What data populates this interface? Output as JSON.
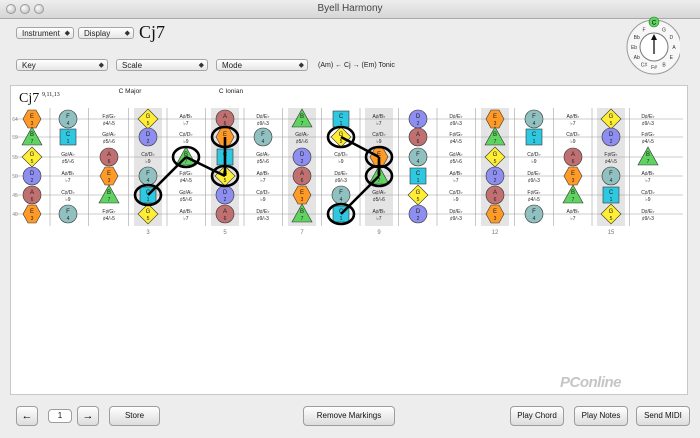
{
  "window": {
    "title": "Byell Harmony"
  },
  "toolbar": {
    "instrument": "Instrument",
    "display": "Display",
    "chord_name": "Cj7",
    "key": "Key",
    "scale": "Scale",
    "mode": "Mode",
    "progression": "(Am) ← Cj → (Em) Tonic"
  },
  "fretboard": {
    "chord_label": "Cj7",
    "chord_extensions": "9,11,13",
    "scale_label": "C Major",
    "mode_label": "C Ionian",
    "fret_numbers": [
      "3",
      "5",
      "7",
      "9",
      "12",
      "15"
    ],
    "string_labels": [
      "64",
      "59",
      "55",
      "50",
      "45",
      "40"
    ],
    "colors": {
      "root": "#2ec8e0",
      "third": "#ff9a26",
      "fifth": "#ffee33",
      "seventh": "#5fd35f",
      "second": "#8e8ef0",
      "fourth": "#90c0c0",
      "sixth": "#c07070",
      "pair": "#f07a1a"
    }
  },
  "bottom": {
    "prev_icon": "←",
    "page": "1",
    "next_icon": "→",
    "store": "Store",
    "remove": "Remove Markings",
    "play_chord": "Play Chord",
    "play_notes": "Play Notes",
    "send_midi": "Send MIDI"
  },
  "circle": {
    "top_note": "C",
    "letters": [
      "G",
      "D",
      "A",
      "E",
      "B",
      "F#",
      "C#",
      "Ab",
      "Eb",
      "Bb",
      "F"
    ],
    "center": "I",
    "labels": [
      "1",
      "3",
      "5",
      "7"
    ]
  },
  "watermark": "PConline"
}
